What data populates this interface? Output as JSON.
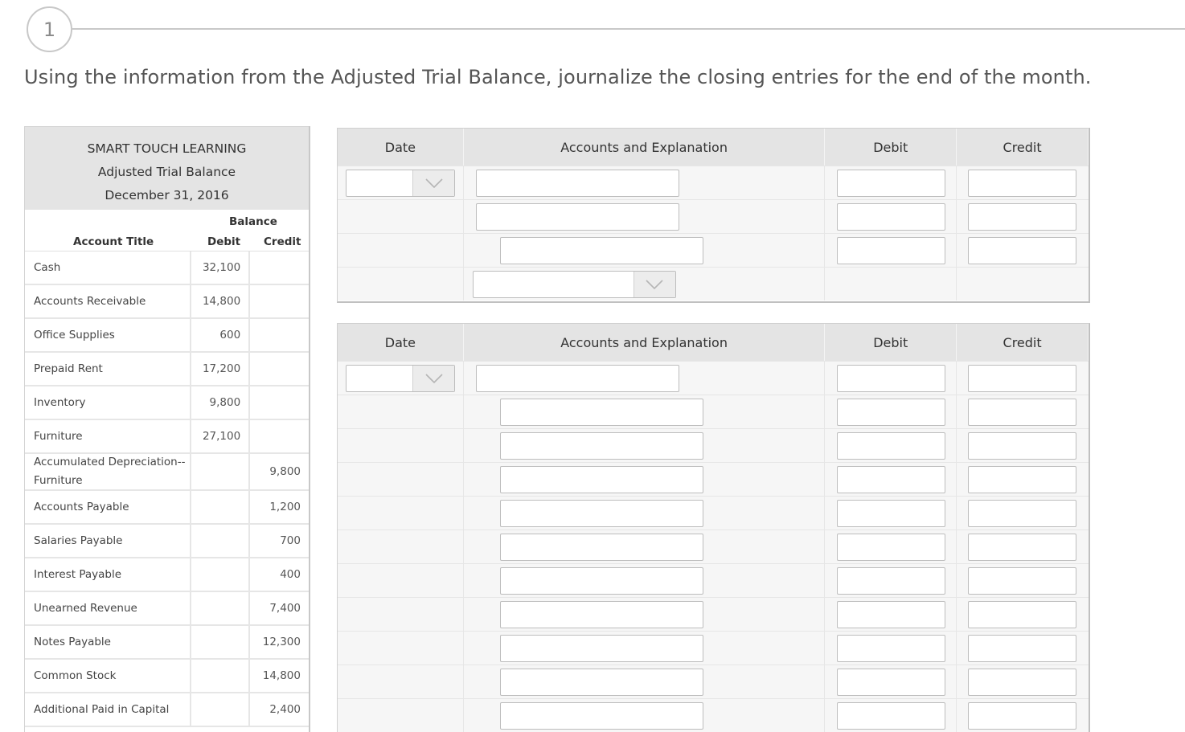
{
  "step": {
    "number": "1"
  },
  "instruction": "Using the information from the Adjusted Trial Balance, journalize the closing entries for the end of the month.",
  "trial_balance": {
    "company": "SMART TOUCH LEARNING",
    "title": "Adjusted Trial Balance",
    "date": "December 31, 2016",
    "balance_label": "Balance",
    "col_account": "Account Title",
    "col_debit": "Debit",
    "col_credit": "Credit",
    "rows": [
      {
        "account": "Cash",
        "debit": "32,100",
        "credit": ""
      },
      {
        "account": "Accounts Receivable",
        "debit": "14,800",
        "credit": ""
      },
      {
        "account": "Office Supplies",
        "debit": "600",
        "credit": ""
      },
      {
        "account": "Prepaid Rent",
        "debit": "17,200",
        "credit": ""
      },
      {
        "account": "Inventory",
        "debit": "9,800",
        "credit": ""
      },
      {
        "account": "Furniture",
        "debit": "27,100",
        "credit": ""
      },
      {
        "account": "Accumulated Depreciation--Furniture",
        "debit": "",
        "credit": "9,800"
      },
      {
        "account": "Accounts Payable",
        "debit": "",
        "credit": "1,200"
      },
      {
        "account": "Salaries Payable",
        "debit": "",
        "credit": "700"
      },
      {
        "account": "Interest Payable",
        "debit": "",
        "credit": "400"
      },
      {
        "account": "Unearned Revenue",
        "debit": "",
        "credit": "7,400"
      },
      {
        "account": "Notes Payable",
        "debit": "",
        "credit": "12,300"
      },
      {
        "account": "Common Stock",
        "debit": "",
        "credit": "14,800"
      },
      {
        "account": "Additional Paid in Capital",
        "debit": "",
        "credit": "2,400"
      }
    ]
  },
  "journal_headers": {
    "date": "Date",
    "accounts": "Accounts and Explanation",
    "debit": "Debit",
    "credit": "Credit"
  },
  "icons": {
    "dropdown": "chevron-down-icon"
  },
  "colors": {
    "header_bg": "#e4e4e4",
    "row_bg": "#f6f6f6",
    "input_border": "#bdbdbd"
  }
}
